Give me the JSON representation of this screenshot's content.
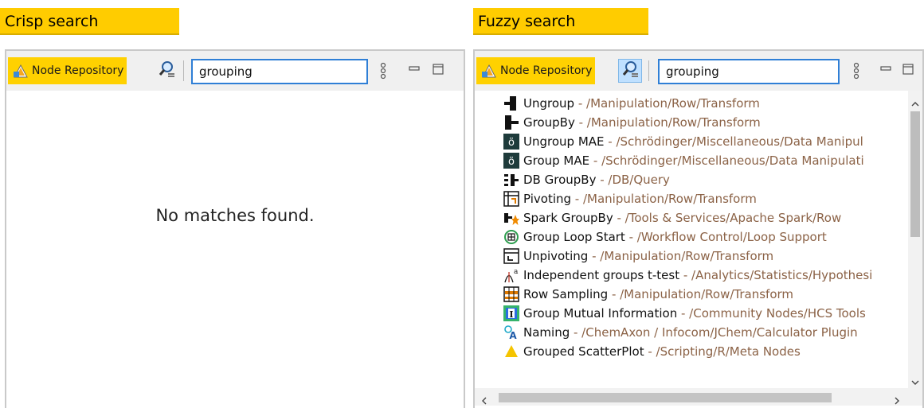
{
  "crisp": {
    "heading": "Crisp search",
    "tab_label": "Node Repository",
    "search_value": "grouping",
    "empty_message": "No matches found."
  },
  "fuzzy": {
    "heading": "Fuzzy search",
    "tab_label": "Node Repository",
    "search_value": "grouping",
    "results": [
      {
        "name": "Ungroup",
        "path": " - /Manipulation/Row/Transform",
        "icon": "ungroup-icon"
      },
      {
        "name": "GroupBy",
        "path": " - /Manipulation/Row/Transform",
        "icon": "groupby-icon"
      },
      {
        "name": "Ungroup MAE",
        "path": " - /Schrödinger/Miscellaneous/Data Manipul",
        "icon": "schrodinger-icon"
      },
      {
        "name": "Group MAE",
        "path": " - /Schrödinger/Miscellaneous/Data Manipulati",
        "icon": "schrodinger-icon"
      },
      {
        "name": "DB GroupBy",
        "path": " - /DB/Query",
        "icon": "db-groupby-icon"
      },
      {
        "name": "Pivoting",
        "path": " - /Manipulation/Row/Transform",
        "icon": "pivoting-icon"
      },
      {
        "name": "Spark GroupBy",
        "path": " - /Tools & Services/Apache Spark/Row",
        "icon": "spark-groupby-icon"
      },
      {
        "name": "Group Loop Start",
        "path": " - /Workflow Control/Loop Support",
        "icon": "loop-start-icon"
      },
      {
        "name": "Unpivoting",
        "path": " - /Manipulation/Row/Transform",
        "icon": "unpivoting-icon"
      },
      {
        "name": "Independent groups t-test",
        "path": " - /Analytics/Statistics/Hypothesi",
        "icon": "t-test-icon"
      },
      {
        "name": "Row Sampling",
        "path": " - /Manipulation/Row/Transform",
        "icon": "row-sampling-icon"
      },
      {
        "name": "Group Mutual Information",
        "path": " - /Community Nodes/HCS Tools",
        "icon": "hcs-tools-icon"
      },
      {
        "name": "Naming",
        "path": " - /ChemAxon / Infocom/JChem/Calculator Plugin",
        "icon": "chemaxon-icon"
      },
      {
        "name": "Grouped ScatterPlot",
        "path": " - /Scripting/R/Meta Nodes",
        "icon": "scatterplot-icon"
      }
    ]
  },
  "colors": {
    "accent_yellow": "#ffcc00",
    "input_border": "#2f7fd6",
    "path_text": "#8b6246",
    "fuzzy_toggle_active": "#bfe0ff"
  }
}
